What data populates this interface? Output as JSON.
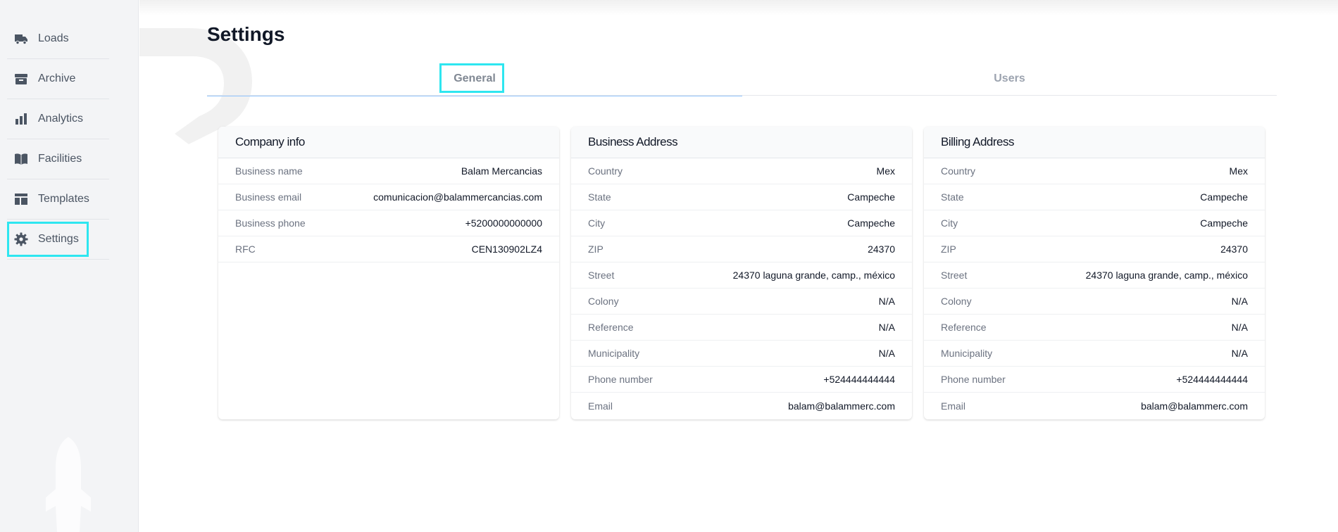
{
  "sidebar": {
    "items": [
      {
        "label": "Loads",
        "icon": "truck-icon"
      },
      {
        "label": "Archive",
        "icon": "archive-icon"
      },
      {
        "label": "Analytics",
        "icon": "bar-chart-icon"
      },
      {
        "label": "Facilities",
        "icon": "book-icon"
      },
      {
        "label": "Templates",
        "icon": "template-icon"
      },
      {
        "label": "Settings",
        "icon": "gear-icon",
        "active": true
      }
    ]
  },
  "page": {
    "title": "Settings"
  },
  "tabs": [
    {
      "label": "General",
      "active": true
    },
    {
      "label": "Users",
      "active": false
    }
  ],
  "cards": {
    "company": {
      "title": "Company info",
      "rows": [
        {
          "key": "Business name",
          "value": "Balam Mercancias"
        },
        {
          "key": "Business email",
          "value": "comunicacion@balammercancias.com"
        },
        {
          "key": "Business phone",
          "value": "+5200000000000"
        },
        {
          "key": "RFC",
          "value": "CEN130902LZ4"
        }
      ]
    },
    "business_address": {
      "title": "Business Address",
      "rows": [
        {
          "key": "Country",
          "value": "Mex"
        },
        {
          "key": "State",
          "value": "Campeche"
        },
        {
          "key": "City",
          "value": "Campeche"
        },
        {
          "key": "ZIP",
          "value": "24370"
        },
        {
          "key": "Street",
          "value": "24370 laguna grande, camp., méxico"
        },
        {
          "key": "Colony",
          "value": "N/A"
        },
        {
          "key": "Reference",
          "value": "N/A"
        },
        {
          "key": "Municipality",
          "value": "N/A"
        },
        {
          "key": "Phone number",
          "value": "+524444444444"
        },
        {
          "key": "Email",
          "value": "balam@balammerc.com"
        }
      ]
    },
    "billing_address": {
      "title": "Billing Address",
      "rows": [
        {
          "key": "Country",
          "value": "Mex"
        },
        {
          "key": "State",
          "value": "Campeche"
        },
        {
          "key": "City",
          "value": "Campeche"
        },
        {
          "key": "ZIP",
          "value": "24370"
        },
        {
          "key": "Street",
          "value": "24370 laguna grande, camp., méxico"
        },
        {
          "key": "Colony",
          "value": "N/A"
        },
        {
          "key": "Reference",
          "value": "N/A"
        },
        {
          "key": "Municipality",
          "value": "N/A"
        },
        {
          "key": "Phone number",
          "value": "+524444444444"
        },
        {
          "key": "Email",
          "value": "balam@balammerc.com"
        }
      ]
    }
  },
  "colors": {
    "accent_highlight": "#2ee6f0",
    "tab_underline": "#93c5fd"
  }
}
